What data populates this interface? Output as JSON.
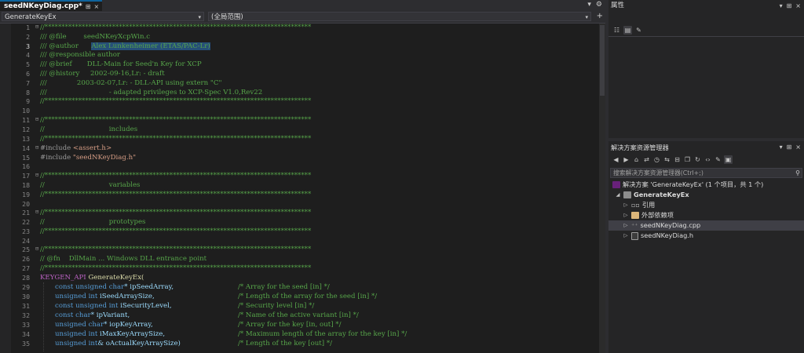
{
  "editor_tab": {
    "title": "seedNKeyDiag.cpp*",
    "pin": "⊞",
    "close": "×"
  },
  "tabbar_right": {
    "dropdown": "▾",
    "settings": "⚙"
  },
  "navbar": {
    "scope": "GenerateKeyEx",
    "member": "(全局范围)",
    "plus": "+"
  },
  "properties_panel": {
    "title": "属性"
  },
  "solution_explorer": {
    "title": "解决方案资源管理器",
    "search_placeholder": "搜索解决方案资源管理器(Ctrl+;)",
    "tree": [
      {
        "label": "解决方案 'GenerateKeyEx' (1 个项目，共 1 个)",
        "level": 0
      },
      {
        "label": "GenerateKeyEx",
        "level": 1,
        "bold": true
      },
      {
        "label": "引用",
        "level": 2
      },
      {
        "label": "外部依赖项",
        "level": 2
      },
      {
        "label": "seedNKeyDiag.cpp",
        "level": 2,
        "selected": true
      },
      {
        "label": "seedNKeyDiag.h",
        "level": 2
      }
    ]
  },
  "code": {
    "line_numbers": [
      "1",
      "2",
      "3",
      "4",
      "5",
      "6",
      "7",
      "8",
      "9",
      "10",
      "11",
      "12",
      "13",
      "14",
      "15",
      "16",
      "17",
      "18",
      "19",
      "20",
      "21",
      "22",
      "23",
      "24",
      "25",
      "26",
      "27",
      "28",
      "29",
      "30",
      "31",
      "32",
      "33",
      "34",
      "35"
    ],
    "current_line": "3",
    "l1": "//*******************************************************************************",
    "l2": "/// @file        seedNKeyXcpWin.c",
    "l3a": "/// @author      ",
    "l3b": "Alex Lunkenheimer (ETAS/PAC-Lr)",
    "l4": "/// @responsible author",
    "l5": "/// @brief       DLL-Main for Seed'n Key for XCP",
    "l6": "/// @history     2002-09-16,Lr: - draft",
    "l7": "///              2003-02-07,Lr: - DLL-API using extern \"C\"",
    "l8": "///                             - adapted privileges to XCP-Spec V1.0,Rev22",
    "l9": "//*******************************************************************************",
    "l11": "//*******************************************************************************",
    "l12": "//                              includes",
    "l13": "//*******************************************************************************",
    "l14a": "#include ",
    "l14b": "<assert.h>",
    "l15a": "#include ",
    "l15b": "\"seedNKeyDiag.h\"",
    "l17": "//*******************************************************************************",
    "l18": "//                              variables",
    "l19": "//*******************************************************************************",
    "l21": "//*******************************************************************************",
    "l22": "//                              prototypes",
    "l23": "//*******************************************************************************",
    "l25": "//*******************************************************************************",
    "l26": "// @fn    DllMain ... Windows DLL entrance point",
    "l27": "//*******************************************************************************",
    "l28a": "KEYGEN_API",
    "l28b": " GenerateKeyEx(",
    "l29a": "const unsigned char",
    "l29b": "* ipSeedArray,",
    "l29c": "/* Array for the seed [in] */",
    "l30a": "unsigned int",
    "l30b": " iSeedArraySize,",
    "l30c": "/* Length of the array for the seed [in] */",
    "l31a": "const unsigned int",
    "l31b": " iSecurityLevel,",
    "l31c": "/* Security level [in] */",
    "l32a": "const char",
    "l32b": "* ipVariant,",
    "l32c": "/* Name of the active variant [in] */",
    "l33a": "unsigned char",
    "l33b": "* iopKeyArray,",
    "l33c": "/* Array for the key [in, out] */",
    "l34a": "unsigned int",
    "l34b": " iMaxKeyArraySize,",
    "l34c": "/* Maximum length of the array for the key [in] */",
    "l35a": "unsigned int",
    "l35b": "& oActualKeyArraySize)",
    "l35c": "/* Length of the key [out] */"
  }
}
